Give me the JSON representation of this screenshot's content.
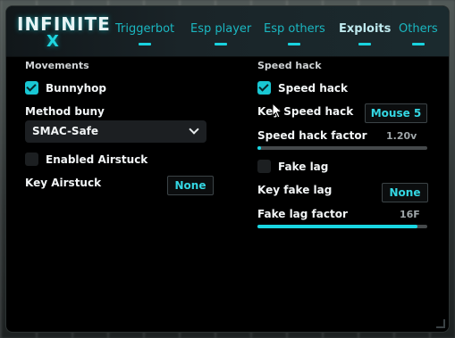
{
  "logo": {
    "line1": "INFINITE",
    "line2": "X"
  },
  "tabs": [
    {
      "label": "Triggerbot"
    },
    {
      "label": "Esp player"
    },
    {
      "label": "Esp others"
    },
    {
      "label": "Exploits",
      "active": true
    },
    {
      "label": "Others"
    }
  ],
  "movements": {
    "title": "Movements",
    "bunnyhop": {
      "label": "Bunnyhop",
      "checked": true
    },
    "method_label": "Method buny",
    "method_value": "SMAC-Safe",
    "airstuck": {
      "label": "Enabled Airstuck",
      "checked": false
    },
    "key_airstuck_label": "Key Airstuck",
    "key_airstuck_value": "None"
  },
  "speedhack": {
    "title": "Speed hack",
    "toggle": {
      "label": "Speed hack",
      "checked": true
    },
    "key_label": "Key Speed hack",
    "key_value": "Mouse 5",
    "factor_label": "Speed hack factor",
    "factor_value": "1.20v",
    "factor_fraction": 0.02,
    "fakelag": {
      "label": "Fake lag",
      "checked": false
    },
    "fakelag_key_label": "Key fake lag",
    "fakelag_key_value": "None",
    "fakelag_factor_label": "Fake lag factor",
    "fakelag_factor_value": "16F",
    "fakelag_factor_fraction": 0.94
  },
  "colors": {
    "accent": "#19d3df",
    "window_bg": "#000000"
  }
}
